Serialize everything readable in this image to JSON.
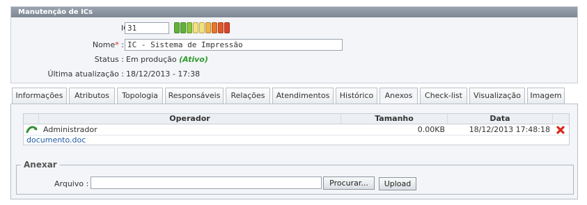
{
  "panel": {
    "title": "Manutenção de ICs"
  },
  "form": {
    "ic_label": "IC :",
    "ic_value": "31",
    "nome_label": "Nome",
    "nome_required": "*",
    "nome_colon": ":",
    "nome_value": "IC - Sistema de Impressão",
    "status_label": "Status :",
    "status_value": "Em produção",
    "status_state": "(Ativo)",
    "atualizacao_label": "Última atualização :",
    "atualizacao_value": "18/12/2013 - 17:38",
    "gauge_colors": [
      "#62b23a",
      "#62b23a",
      "#8cc63f",
      "#f3e17a",
      "#f3e17a",
      "#f0b34a",
      "#e8772b",
      "#e0572b",
      "#d9452a"
    ]
  },
  "tabs": [
    {
      "label": "Informações"
    },
    {
      "label": "Atributos"
    },
    {
      "label": "Topologia"
    },
    {
      "label": "Responsáveis"
    },
    {
      "label": "Relações"
    },
    {
      "label": "Atendimentos"
    },
    {
      "label": "Histórico"
    },
    {
      "label": "Anexos",
      "active": true
    },
    {
      "label": "Check-list"
    },
    {
      "label": "Visualização"
    },
    {
      "label": "Imagem"
    }
  ],
  "attachments": {
    "headers": {
      "operador": "Operador",
      "tamanho": "Tamanho",
      "data": "Data"
    },
    "rows": [
      {
        "operador": "Administrador",
        "tamanho": "0.00KB",
        "data": "18/12/2013 17:48:18",
        "file": "documento.doc"
      }
    ]
  },
  "anexar": {
    "legend": "Anexar",
    "arquivo_label": "Arquivo :",
    "arquivo_value": "",
    "browse_label": "Procurar...",
    "upload_label": "Upload"
  }
}
